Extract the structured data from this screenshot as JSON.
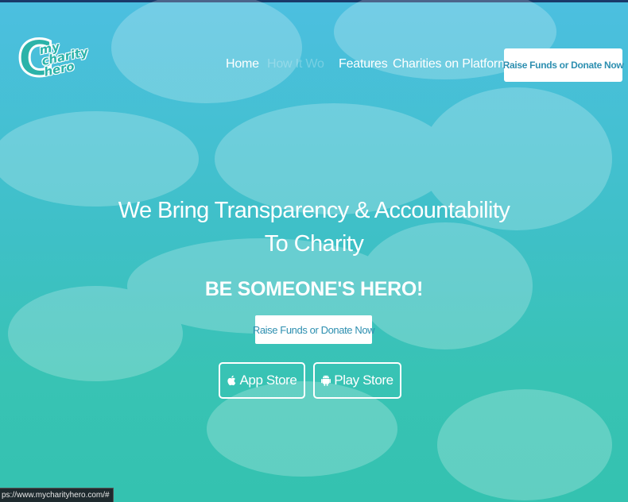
{
  "logo": {
    "letter": "C",
    "line1": "my",
    "line2": "charity",
    "line3": "hero"
  },
  "nav": {
    "items": [
      {
        "label": "Home"
      },
      {
        "label": "How It Wo"
      },
      {
        "label": "Features"
      },
      {
        "label": "Charities on Platform"
      }
    ],
    "cta_label": "Raise Funds or Donate Now"
  },
  "hero": {
    "headline_line1": "We Bring Transparency & Accountability",
    "headline_line2": "To Charity",
    "tagline": "BE SOMEONE'S HERO!",
    "cta_label": "Raise Funds or Donate Now",
    "app_store": {
      "label": "App Store",
      "icon": "apple-icon"
    },
    "play_store": {
      "label": "Play Store",
      "icon": "android-icon"
    }
  },
  "status": {
    "url": "ps://www.mycharityhero.com/#"
  },
  "colors": {
    "primary_teal": "#3fc0c8",
    "button_text": "#2d8fb0",
    "white": "#ffffff"
  }
}
